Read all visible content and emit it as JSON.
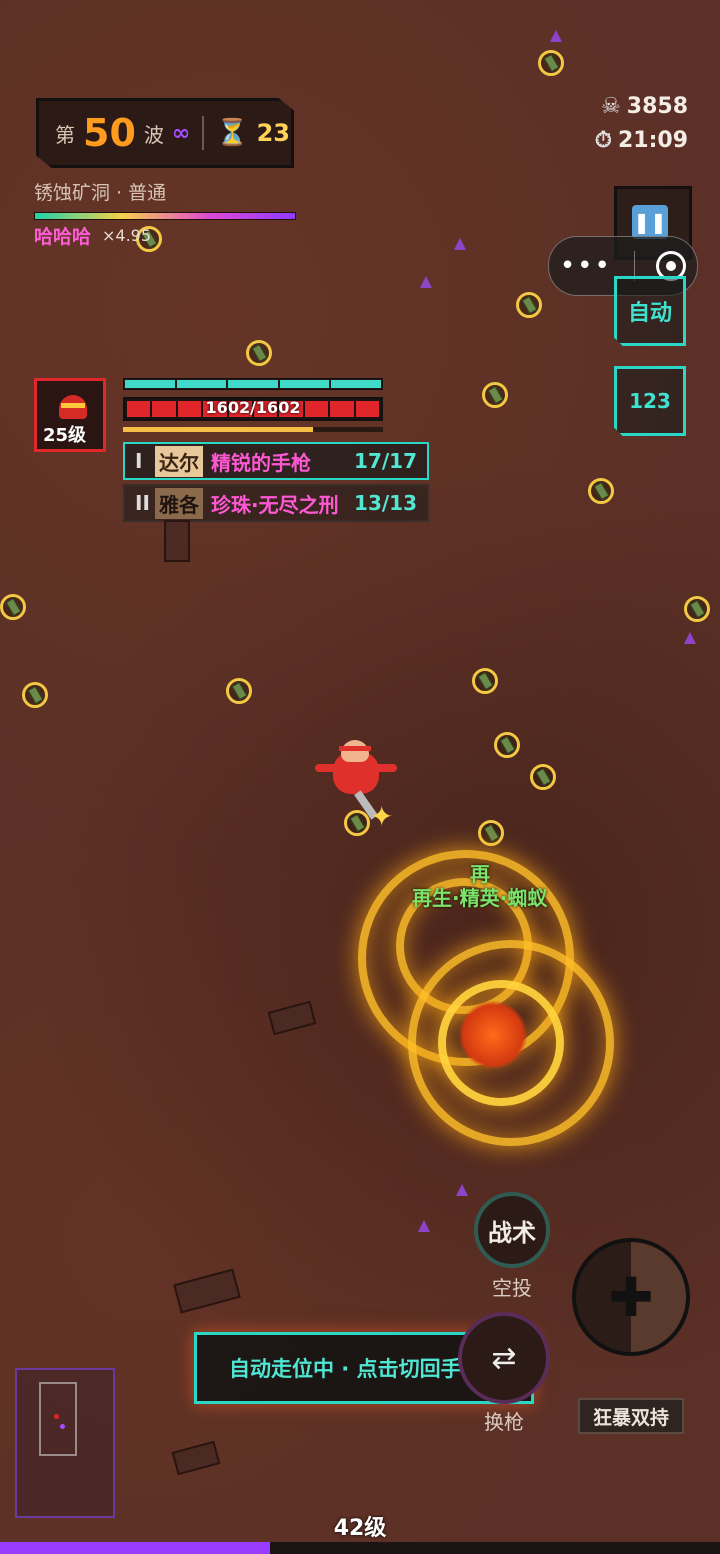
{
  "hud": {
    "wave_prefix": "第",
    "wave_number": "50",
    "wave_suffix": "波",
    "wave_infinite": "∞",
    "wave_timer": "23",
    "zone_name": "锈蚀矿洞 · 普通",
    "player_name": "哈哈哈",
    "multiplier": "×4.95",
    "kills": "3858",
    "elapsed_time": "21:09"
  },
  "side_buttons": {
    "auto_label": "自动",
    "num_label": "123"
  },
  "player": {
    "level_label": "25级",
    "hp_text": "1602/1602",
    "xp_fraction": 0.73
  },
  "weapons": [
    {
      "index": "I",
      "tag": "达尔",
      "name": "精锐的手枪",
      "ammo": "17/17"
    },
    {
      "index": "II",
      "tag": "雅各",
      "name": "珍珠·无尽之刑",
      "ammo": "13/13"
    }
  ],
  "floating_text": {
    "line1": "再",
    "line2": "再生·精英·蜘蚁"
  },
  "controls": {
    "tactic_label": "战术",
    "airdrop_label": "空投",
    "swap_icon": "⇄",
    "swap_label": "换枪",
    "frenzy_label": "狂暴双持",
    "hint_text": "自动走位中 · 点击切回手动"
  },
  "bottom": {
    "level_text": "42级",
    "xp_fraction": 0.375
  },
  "icons": [
    "skull-icon",
    "clock-icon",
    "hourglass-icon",
    "pause-icon",
    "more-icon",
    "target-icon",
    "plus-icon",
    "swap-icon"
  ],
  "colors": {
    "accent_cyan": "#2ad7c6",
    "wave_orange": "#ff9b1f",
    "name_pink": "#ff58d4",
    "hp_red": "#e0262b",
    "xp_purple": "#9a3cff"
  }
}
